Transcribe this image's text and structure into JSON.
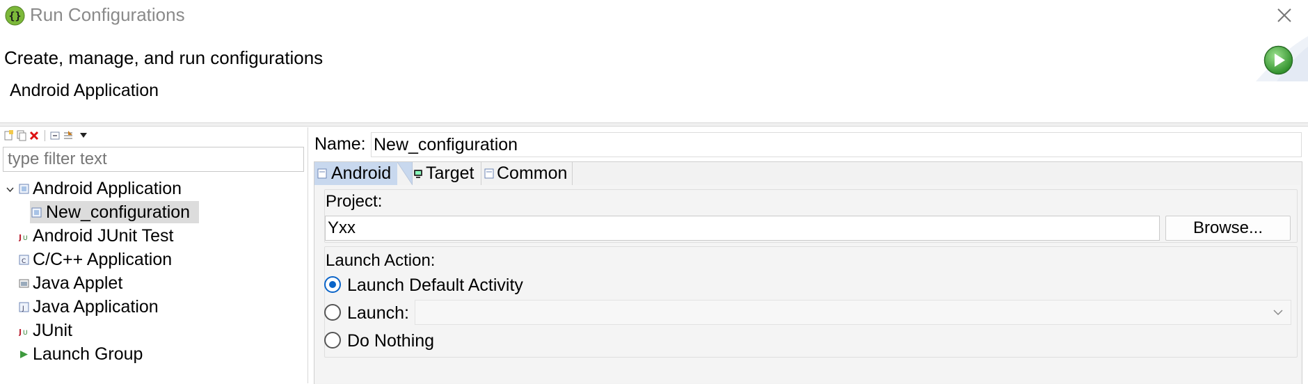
{
  "window": {
    "title": "Run Configurations",
    "header_title": "Create, manage, and run configurations",
    "header_subtitle": "Android Application"
  },
  "left": {
    "filter_placeholder": "type filter text",
    "tree": [
      {
        "label": "Android Application",
        "icon": "android-app-icon",
        "expanded": true
      },
      {
        "label": "New_configuration",
        "icon": "config-icon",
        "selected": true
      },
      {
        "label": "Android JUnit Test",
        "icon": "junit-icon"
      },
      {
        "label": "C/C++ Application",
        "icon": "c-app-icon"
      },
      {
        "label": "Java Applet",
        "icon": "applet-icon"
      },
      {
        "label": "Java Application",
        "icon": "java-app-icon"
      },
      {
        "label": "JUnit",
        "icon": "junit-icon"
      },
      {
        "label": "Launch Group",
        "icon": "launch-group-icon"
      }
    ]
  },
  "right": {
    "name_label": "Name:",
    "name_value": "New_configuration",
    "tabs": [
      {
        "label": "Android",
        "active": true
      },
      {
        "label": "Target"
      },
      {
        "label": "Common"
      }
    ],
    "project_label": "Project:",
    "project_value": "Yxx",
    "browse_label": "Browse...",
    "launch_action_label": "Launch Action:",
    "radios": [
      {
        "label": "Launch Default Activity",
        "selected": true
      },
      {
        "label": "Launch:",
        "selected": false
      },
      {
        "label": "Do Nothing",
        "selected": false
      }
    ]
  },
  "colors": {
    "accent": "#0a64c8",
    "run_green": "#3aa83a",
    "selection": "#dcdcdc"
  }
}
